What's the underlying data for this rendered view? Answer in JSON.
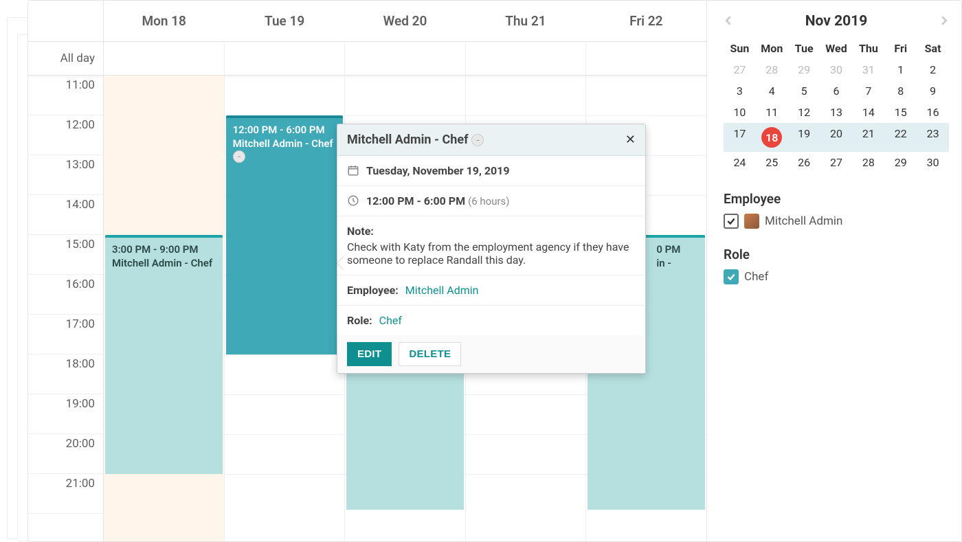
{
  "header": {
    "days": [
      "Mon 18",
      "Tue 19",
      "Wed 20",
      "Thu 21",
      "Fri 22"
    ],
    "allday_label": "All day"
  },
  "times": [
    "11:00",
    "12:00",
    "13:00",
    "14:00",
    "15:00",
    "16:00",
    "17:00",
    "18:00",
    "19:00",
    "20:00",
    "21:00"
  ],
  "events": {
    "mon": {
      "time": "3:00 PM - 9:00 PM",
      "who": "Mitchell Admin - Chef"
    },
    "tue": {
      "time": "12:00 PM - 6:00 PM",
      "who": "Mitchell Admin - Chef"
    },
    "wed": {
      "time": "",
      "who": ""
    },
    "fri": {
      "time": "",
      "who": ""
    },
    "fri_partial_time": "0 PM",
    "fri_partial_who": "in -"
  },
  "popover": {
    "title": "Mitchell Admin - Chef",
    "date": "Tuesday, November 19, 2019",
    "time": "12:00 PM - 6:00 PM",
    "duration": "(6 hours)",
    "note_label": "Note:",
    "note_body": "Check with Katy from the employment agency if they have someone to replace Randall this day.",
    "employee_label": "Employee:",
    "employee_value": "Mitchell Admin",
    "role_label": "Role:",
    "role_value": "Chef",
    "edit": "EDIT",
    "delete": "DELETE"
  },
  "mini": {
    "month": "Nov 2019",
    "dow": [
      "Sun",
      "Mon",
      "Tue",
      "Wed",
      "Thu",
      "Fri",
      "Sat"
    ],
    "weeks": [
      [
        {
          "n": "27",
          "o": true
        },
        {
          "n": "28",
          "o": true
        },
        {
          "n": "29",
          "o": true
        },
        {
          "n": "30",
          "o": true
        },
        {
          "n": "31",
          "o": true
        },
        {
          "n": "1"
        },
        {
          "n": "2"
        }
      ],
      [
        {
          "n": "3"
        },
        {
          "n": "4"
        },
        {
          "n": "5"
        },
        {
          "n": "6"
        },
        {
          "n": "7"
        },
        {
          "n": "8"
        },
        {
          "n": "9"
        }
      ],
      [
        {
          "n": "10"
        },
        {
          "n": "11"
        },
        {
          "n": "12"
        },
        {
          "n": "13"
        },
        {
          "n": "14"
        },
        {
          "n": "15"
        },
        {
          "n": "16"
        }
      ],
      [
        {
          "n": "17"
        },
        {
          "n": "18",
          "t": true
        },
        {
          "n": "19"
        },
        {
          "n": "20"
        },
        {
          "n": "21"
        },
        {
          "n": "22"
        },
        {
          "n": "23"
        }
      ],
      [
        {
          "n": "24"
        },
        {
          "n": "25"
        },
        {
          "n": "26"
        },
        {
          "n": "27"
        },
        {
          "n": "28"
        },
        {
          "n": "29"
        },
        {
          "n": "30"
        }
      ]
    ]
  },
  "filters": {
    "employee_title": "Employee",
    "employee_name": "Mitchell Admin",
    "role_title": "Role",
    "role_name": "Chef"
  }
}
